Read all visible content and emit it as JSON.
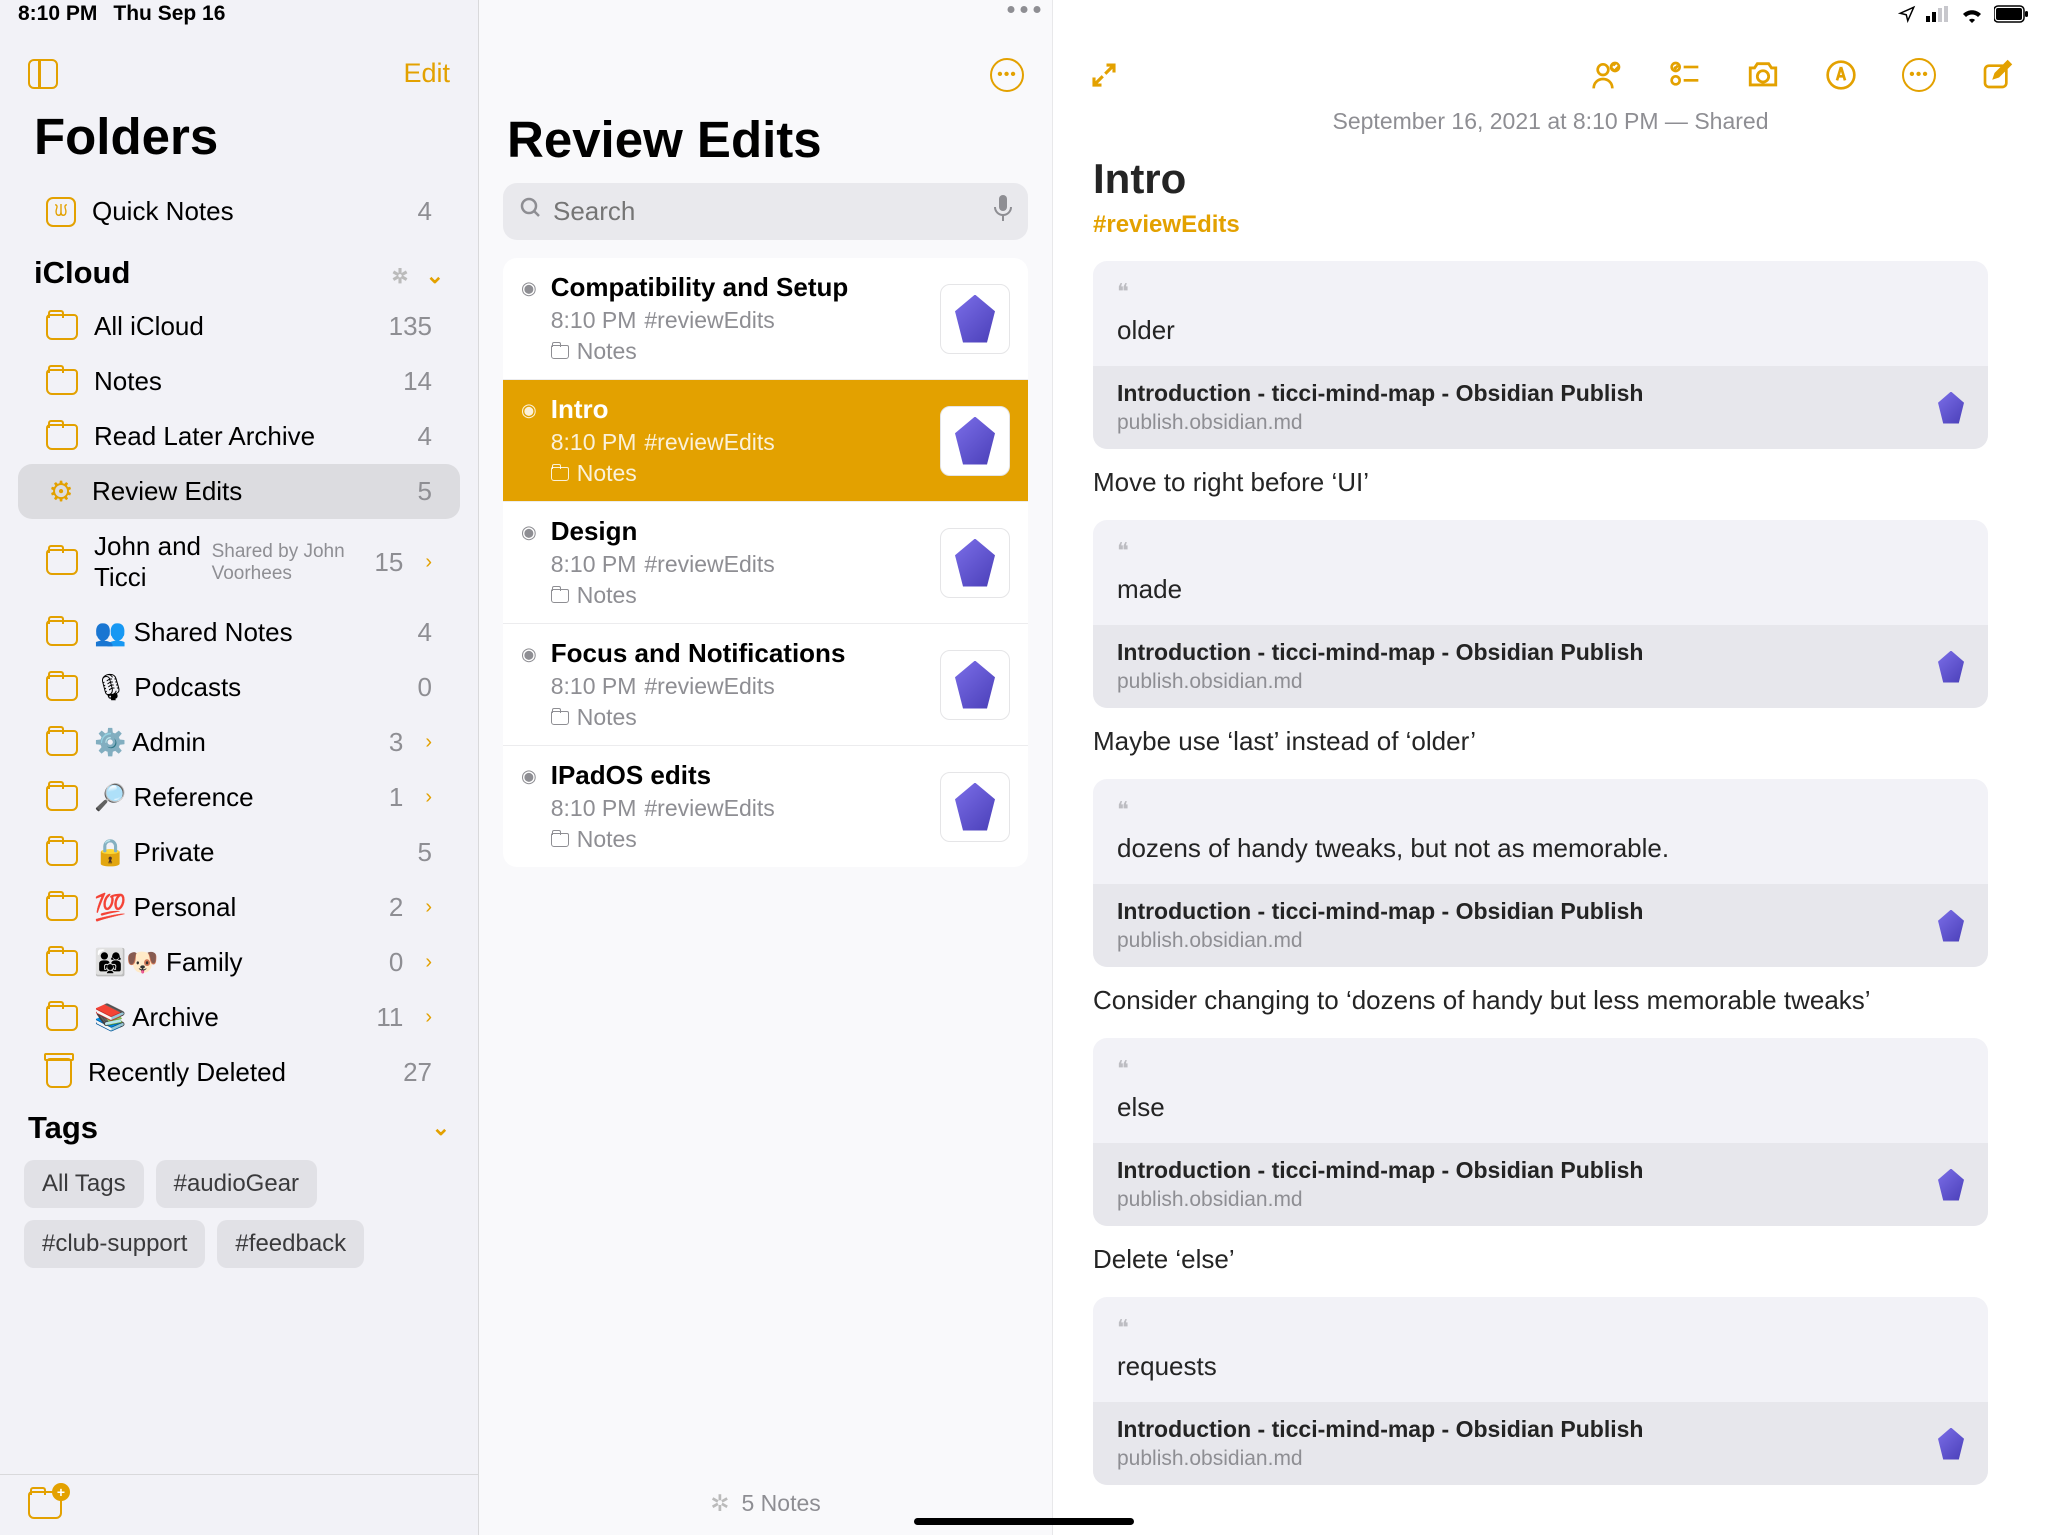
{
  "status": {
    "time": "8:10 PM",
    "date": "Thu Sep 16"
  },
  "sidebar": {
    "edit": "Edit",
    "title": "Folders",
    "quick": {
      "name": "Quick Notes",
      "count": "4"
    },
    "section": "iCloud",
    "folders": [
      {
        "name": "All iCloud",
        "count": "135",
        "chevron": false,
        "icon": "folder"
      },
      {
        "name": "Notes",
        "count": "14",
        "chevron": false,
        "icon": "folder"
      },
      {
        "name": "Read Later Archive",
        "count": "4",
        "chevron": false,
        "icon": "folder"
      },
      {
        "name": "Review Edits",
        "count": "5",
        "chevron": false,
        "icon": "gear",
        "selected": true
      },
      {
        "name": "John and Ticci",
        "count": "15",
        "chevron": true,
        "icon": "folder-shared",
        "sub": "Shared by John Voorhees"
      },
      {
        "name": "Shared Notes",
        "count": "4",
        "chevron": false,
        "icon": "folder",
        "emoji": "👥"
      },
      {
        "name": "Podcasts",
        "count": "0",
        "chevron": false,
        "icon": "folder",
        "emoji": "🎙"
      },
      {
        "name": "Admin",
        "count": "3",
        "chevron": true,
        "icon": "folder",
        "emoji": "⚙️"
      },
      {
        "name": "Reference",
        "count": "1",
        "chevron": true,
        "icon": "folder",
        "emoji": "🔎"
      },
      {
        "name": "Private",
        "count": "5",
        "chevron": false,
        "icon": "folder",
        "emoji": "🔒"
      },
      {
        "name": "Personal",
        "count": "2",
        "chevron": true,
        "icon": "folder",
        "emoji": "💯"
      },
      {
        "name": "Family",
        "count": "0",
        "chevron": true,
        "icon": "folder",
        "emoji": "👨‍👩‍👧🐶"
      },
      {
        "name": "Archive",
        "count": "11",
        "chevron": true,
        "icon": "folder",
        "emoji": "📚"
      },
      {
        "name": "Recently Deleted",
        "count": "27",
        "chevron": false,
        "icon": "trash"
      }
    ],
    "tags_header": "Tags",
    "tags": [
      "All Tags",
      "#audioGear",
      "#club-support",
      "#feedback"
    ]
  },
  "middle": {
    "title": "Review Edits",
    "search_placeholder": "Search",
    "notes": [
      {
        "title": "Compatibility and Setup",
        "time": "8:10 PM",
        "tag": "#reviewEdits",
        "folder": "Notes"
      },
      {
        "title": "Intro",
        "time": "8:10 PM",
        "tag": "#reviewEdits",
        "folder": "Notes",
        "selected": true
      },
      {
        "title": "Design",
        "time": "8:10 PM",
        "tag": "#reviewEdits",
        "folder": "Notes"
      },
      {
        "title": "Focus and Notifications",
        "time": "8:10 PM",
        "tag": "#reviewEdits",
        "folder": "Notes"
      },
      {
        "title": "IPadOS edits",
        "time": "8:10 PM",
        "tag": "#reviewEdits",
        "folder": "Notes"
      }
    ],
    "count": "5 Notes"
  },
  "editor": {
    "meta": "September 16, 2021 at 8:10 PM — Shared",
    "title": "Intro",
    "tag": "#reviewEdits",
    "link_title": "Introduction - ticci-mind-map - Obsidian Publish",
    "link_url": "publish.obsidian.md",
    "blocks": [
      {
        "quote": "older",
        "comment": "Move to right before ‘UI’"
      },
      {
        "quote": "made",
        "comment": "Maybe use ‘last’ instead of ‘older’"
      },
      {
        "quote": "dozens of handy tweaks, but not as memorable.",
        "comment": "Consider changing to ‘dozens of handy but less memorable tweaks’"
      },
      {
        "quote": "else",
        "comment": "Delete ‘else’"
      },
      {
        "quote": "requests",
        "comment": ""
      }
    ]
  }
}
